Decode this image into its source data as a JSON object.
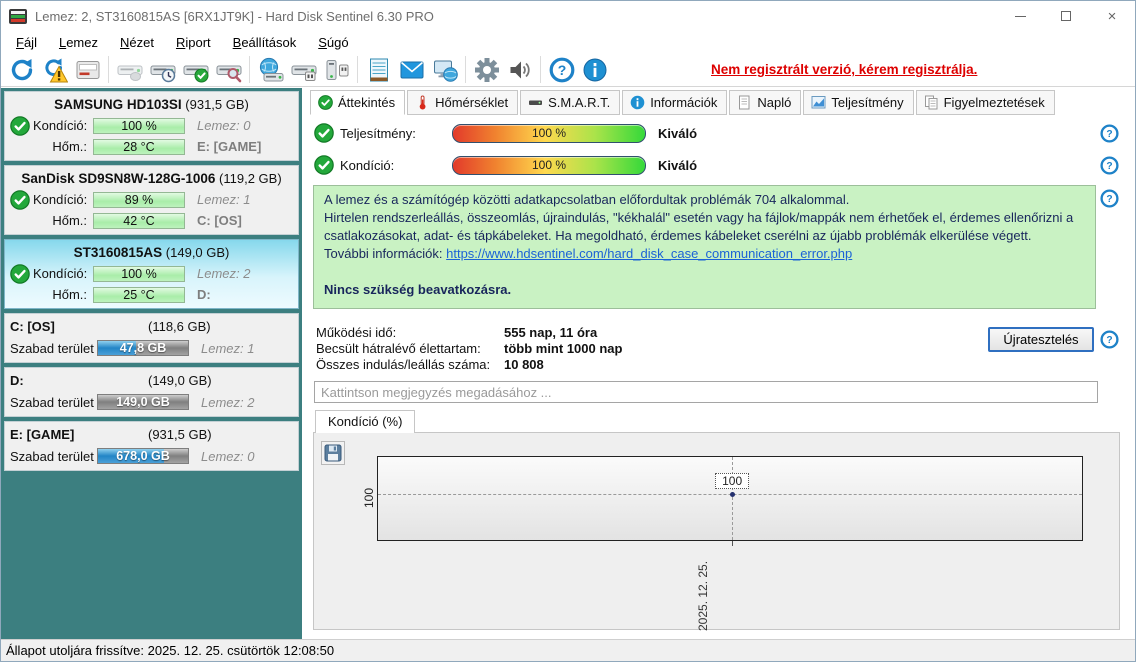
{
  "window": {
    "title": "Lemez: 2, ST3160815AS [6RX1JT9K]  -  Hard Disk Sentinel 6.30 PRO"
  },
  "menu": {
    "items": [
      "Fájl",
      "Lemez",
      "Nézet",
      "Riport",
      "Beállítások",
      "Súgó"
    ]
  },
  "toolbar": {
    "registration_notice": "Nem regisztrált verzió, kérem regisztrálja.",
    "icons": [
      "refresh-icon",
      "refresh-warning-icon",
      "report-icon",
      "disk-offline-icon",
      "disk-schedule-icon",
      "disk-accept-icon",
      "disk-surface-test-icon",
      "network-disk-icon",
      "disk-power-icon",
      "disk-connect-icon",
      "log-icon",
      "mail-icon",
      "remote-monitor-icon",
      "settings-gear-icon",
      "sound-icon",
      "help-icon",
      "info-icon"
    ]
  },
  "sidebar": {
    "labels": {
      "condition": "Kondíció:",
      "temperature": "Hőm.:",
      "free_space": "Szabad terület"
    },
    "disks": [
      {
        "name": "SAMSUNG HD103SI",
        "size": "(931,5 GB)",
        "condition": "100 %",
        "temperature": "28 °C",
        "disk_no": "Lemez: 0",
        "drive": "E: [GAME]"
      },
      {
        "name": "SanDisk SD9SN8W-128G-1006",
        "size": "(119,2 GB)",
        "condition": "89 %",
        "temperature": "42 °C",
        "disk_no": "Lemez: 1",
        "drive": "C: [OS]"
      },
      {
        "name": "ST3160815AS",
        "size": "(149,0 GB)",
        "condition": "100 %",
        "temperature": "25 °C",
        "disk_no": "Lemez: 2",
        "drive": "D:"
      }
    ],
    "partitions": [
      {
        "name": "C: [OS]",
        "size": "(118,6 GB)",
        "free": "47,8 GB",
        "free_width": "42%",
        "disk_no": "Lemez: 1"
      },
      {
        "name": "D:",
        "size": "(149,0 GB)",
        "free": "149,0 GB",
        "free_width": "0%",
        "disk_no": "Lemez: 2"
      },
      {
        "name": "E: [GAME]",
        "size": "(931,5 GB)",
        "free": "678,0 GB",
        "free_width": "73%",
        "disk_no": "Lemez: 0"
      }
    ]
  },
  "tabs": [
    {
      "label": "Áttekintés",
      "icon": "status-ok-icon"
    },
    {
      "label": "Hőmérséklet",
      "icon": "thermometer-icon"
    },
    {
      "label": "S.M.A.R.T.",
      "icon": "disk-icon"
    },
    {
      "label": "Információk",
      "icon": "info-icon"
    },
    {
      "label": "Napló",
      "icon": "document-icon"
    },
    {
      "label": "Teljesítmény",
      "icon": "chart-icon"
    },
    {
      "label": "Figyelmeztetések",
      "icon": "documents-icon"
    }
  ],
  "overview": {
    "performance": {
      "label": "Teljesítmény:",
      "value": "100 %",
      "rating": "Kiváló"
    },
    "condition": {
      "label": "Kondíció:",
      "value": "100 %",
      "rating": "Kiváló"
    },
    "message": {
      "line1": "A lemez és a számítógép közötti adatkapcsolatban előfordultak problémák 704 alkalommal.",
      "line2": "Hirtelen rendszerleállás, összeomlás, újraindulás, \"kékhalál\" esetén vagy ha fájlok/mappák nem érhetőek el, érdemes ellenőrizni a csatlakozásokat, adat- és tápkábeleket. Ha megoldható, érdemes kábeleket cserélni az újabb problémák elkerülése végett.",
      "more_info_label": "További információk: ",
      "link": "https://www.hdsentinel.com/hard_disk_case_communication_error.php",
      "action": "Nincs szükség beavatkozásra."
    },
    "stats": [
      {
        "label": "Működési idő:",
        "value": "555 nap, 11 óra"
      },
      {
        "label": "Becsült hátralévő élettartam:",
        "value": "több mint 1000 nap"
      },
      {
        "label": "Összes indulás/leállás száma:",
        "value": "10 808"
      }
    ],
    "retest_button": "Újratesztelés",
    "comment_placeholder": "Kattintson megjegyzés megadásához ..."
  },
  "chart": {
    "tab_label": "Kondíció  (%)",
    "y_tick": "100",
    "point_label": "100",
    "x_tick": "2025. 12. 25."
  },
  "chart_data": {
    "type": "line",
    "title": "Kondíció (%)",
    "x": [
      "2025. 12. 25."
    ],
    "series": [
      {
        "name": "Kondíció (%)",
        "values": [
          100
        ]
      }
    ],
    "ylabel": "Kondíció (%)",
    "y_ticks": [
      100
    ],
    "grid": "dashed",
    "legend_position": "none"
  },
  "status_bar": {
    "text": "Állapot utoljára frissítve: 2025. 12. 25. csütörtök 12:08:50"
  },
  "colors": {
    "sidebar_background": "#3c7f80",
    "selection_highlight": "#86d8ec",
    "condition_bar_green": "#a9eda9",
    "free_space_blue": "#2285c6",
    "registration_red": "#dd0000",
    "message_box_green": "#c9f2c3",
    "accent_blue": "#1e82c8"
  }
}
